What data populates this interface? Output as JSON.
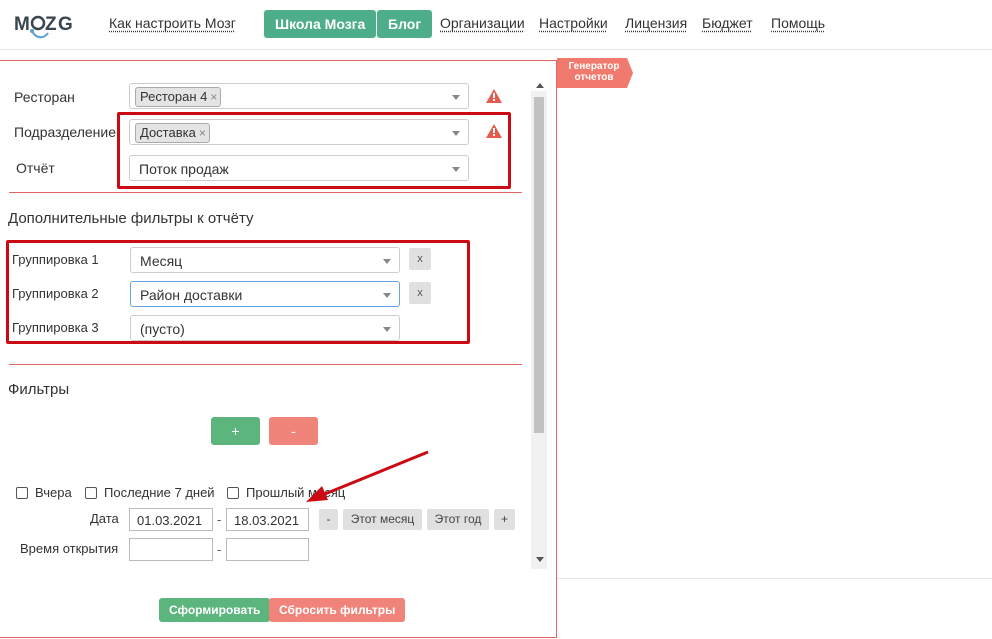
{
  "logo": {
    "alt": "MOZG"
  },
  "nav": {
    "how_to": "Как настроить Мозг",
    "school": "Школа Мозга",
    "blog": "Блог",
    "orgs": "Организации",
    "settings": "Настройки",
    "license": "Лицензия",
    "budget": "Бюджет",
    "help": "Помощь"
  },
  "generator_badge": {
    "line1": "Генератор",
    "line2": "отчетов"
  },
  "form": {
    "restaurant": {
      "label": "Ресторан",
      "tag": "Ресторан 4"
    },
    "division": {
      "label": "Подразделение",
      "tag": "Доставка"
    },
    "report": {
      "label": "Отчёт",
      "value": "Поток продаж"
    }
  },
  "extra_filters": {
    "title": "Дополнительные фильтры к отчёту",
    "groupings": [
      {
        "label": "Группировка 1",
        "value": "Месяц",
        "remove": "x"
      },
      {
        "label": "Группировка 2",
        "value": "Район доставки",
        "remove": "x"
      },
      {
        "label": "Группировка 3",
        "value": "(пусто)"
      }
    ]
  },
  "filters": {
    "title": "Фильтры",
    "add": "+",
    "remove": "-",
    "checkboxes": [
      "Вчера",
      "Последние 7 дней",
      "Прошлый месяц"
    ],
    "date": {
      "label": "Дата",
      "from": "01.03.2021",
      "sep": "-",
      "to": "18.03.2021"
    },
    "date_buttons": {
      "minus": "-",
      "this_month": "Этот месяц",
      "this_year": "Этот год",
      "plus": "+"
    },
    "open_time": {
      "label": "Время открытия",
      "sep": "-"
    }
  },
  "actions": {
    "generate": "Сформировать",
    "reset": "Сбросить фильтры"
  },
  "colors": {
    "accent_green": "#4fae8a",
    "highlight_red": "#cc0a13",
    "warning": "#e55b4d"
  }
}
